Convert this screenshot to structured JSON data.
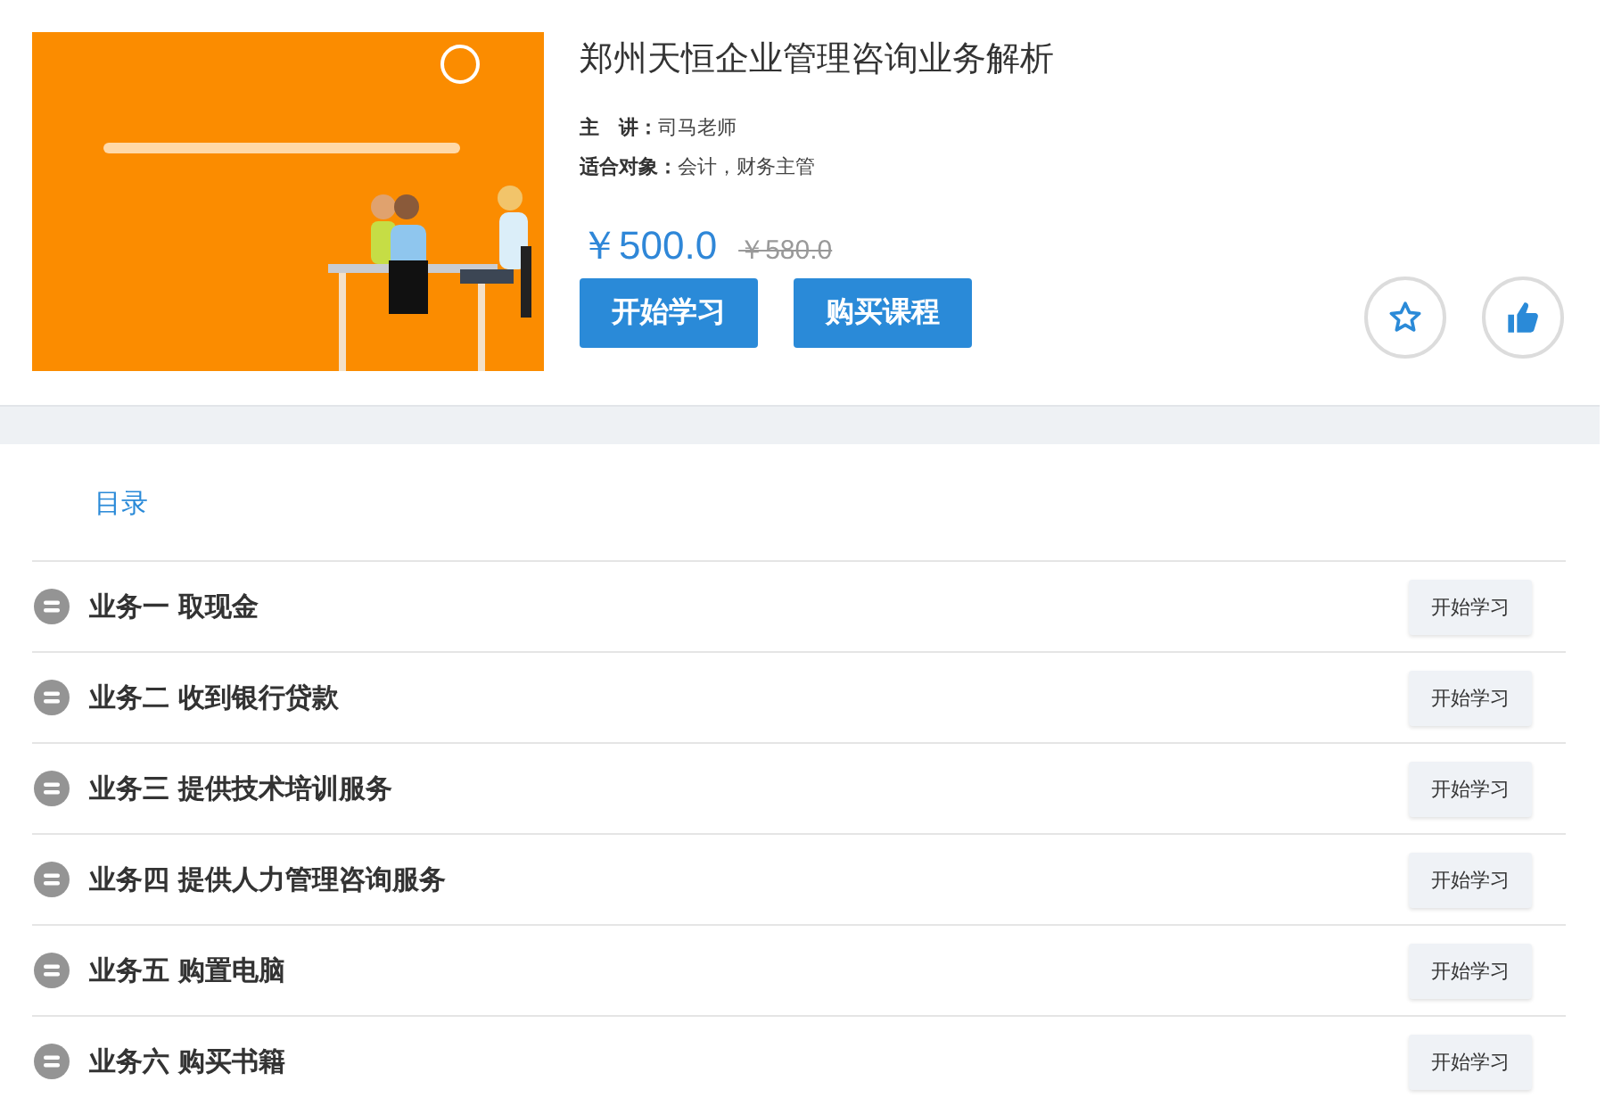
{
  "course": {
    "title": "郑州天恒企业管理咨询业务解析",
    "meta": [
      {
        "label": "主　讲：",
        "value": "司马老师"
      },
      {
        "label": "适合对象：",
        "value": "会计，财务主管"
      }
    ],
    "price": "￥500.0",
    "original_price": "￥580.0",
    "buttons": [
      "开始学习",
      "购买课程"
    ],
    "favorited": false,
    "liked": false
  },
  "catalog": {
    "tab": "目录",
    "lessons": [
      {
        "title": "业务一 取现金",
        "action": "开始学习"
      },
      {
        "title": "业务二 收到银行贷款",
        "action": "开始学习"
      },
      {
        "title": "业务三 提供技术培训服务",
        "action": "开始学习"
      },
      {
        "title": "业务四 提供人力管理咨询服务",
        "action": "开始学习"
      },
      {
        "title": "业务五 购置电脑",
        "action": "开始学习"
      },
      {
        "title": "业务六 购买书籍",
        "action": "开始学习"
      }
    ]
  }
}
